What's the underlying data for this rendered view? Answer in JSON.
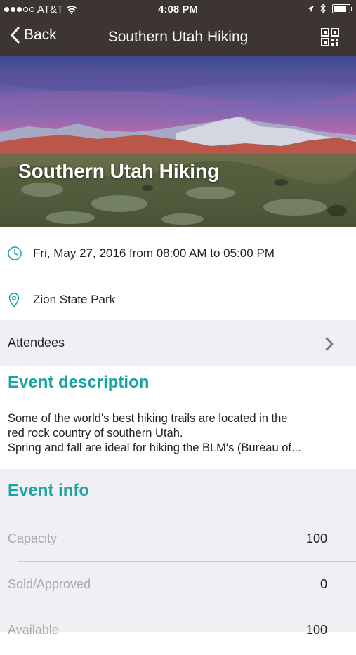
{
  "status_bar": {
    "carrier": "AT&T",
    "time": "4:08 PM"
  },
  "nav": {
    "back_label": "Back",
    "title": "Southern Utah Hiking"
  },
  "hero": {
    "title": "Southern Utah Hiking"
  },
  "event": {
    "datetime": "Fri, May 27, 2016 from 08:00 AM to 05:00 PM",
    "location": "Zion State Park"
  },
  "attendees": {
    "label": "Attendees"
  },
  "description": {
    "heading": "Event description",
    "lines": [
      "Some of the world's best hiking trails are located in the",
      "red rock country of southern Utah.",
      "Spring and fall are ideal for hiking the BLM's (Bureau of..."
    ]
  },
  "info": {
    "heading": "Event info",
    "rows": [
      {
        "label": "Capacity",
        "value": "100"
      },
      {
        "label": "Sold/Approved",
        "value": "0"
      },
      {
        "label": "Available",
        "value": "100"
      }
    ]
  },
  "colors": {
    "accent": "#1aa3a3",
    "nav_bg": "#3d3531",
    "section_bg": "#efeff4"
  }
}
